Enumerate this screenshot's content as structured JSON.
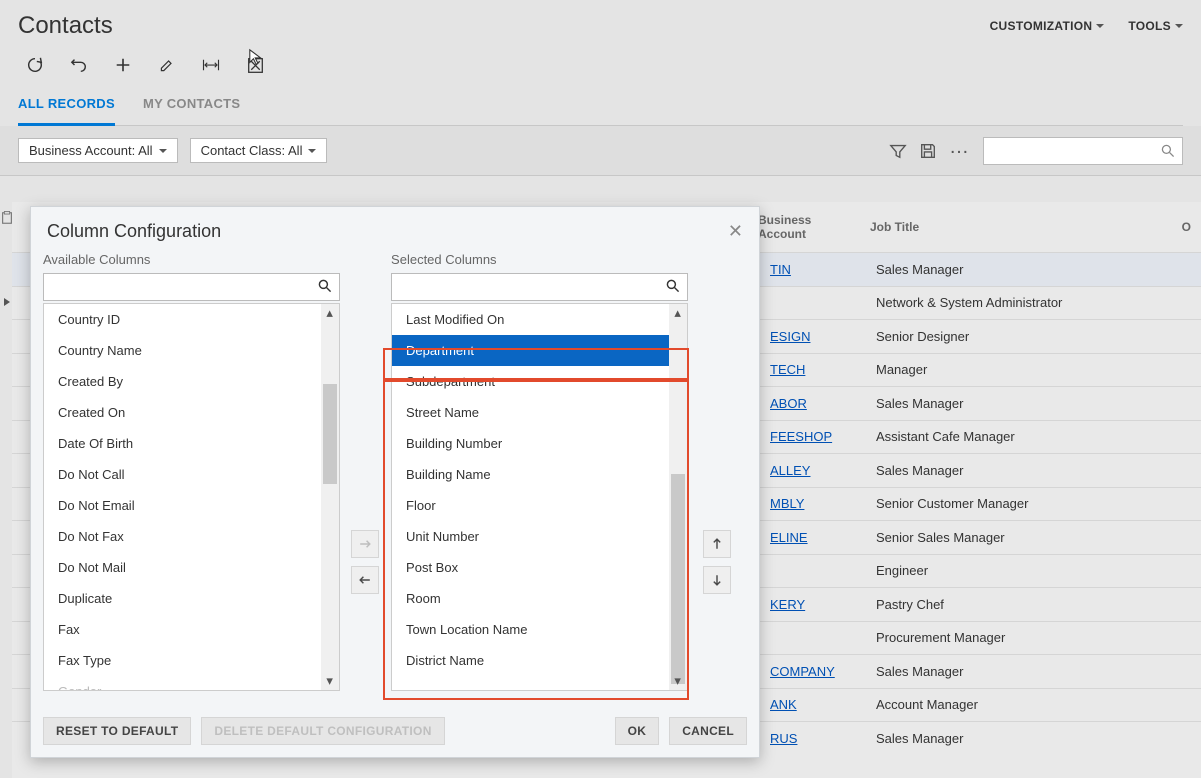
{
  "header": {
    "title": "Contacts",
    "menu": {
      "customization": "CUSTOMIZATION",
      "tools": "TOOLS"
    }
  },
  "tabs": {
    "all": "ALL RECORDS",
    "my": "MY CONTACTS"
  },
  "filters": {
    "businessAccount": "Business Account: All",
    "contactClass": "Contact Class: All"
  },
  "table": {
    "columns": {
      "business": "Business\nAccount",
      "jobTitle": "Job Title"
    },
    "rows": [
      {
        "business": "TIN",
        "jobTitle": "Sales Manager",
        "selected": true
      },
      {
        "business": "",
        "jobTitle": "Network & System Administrator"
      },
      {
        "business": "ESIGN",
        "jobTitle": "Senior Designer"
      },
      {
        "business": "TECH",
        "jobTitle": "Manager"
      },
      {
        "business": "ABOR",
        "jobTitle": "Sales Manager"
      },
      {
        "business": "FEESHOP",
        "jobTitle": "Assistant Cafe Manager"
      },
      {
        "business": "ALLEY",
        "jobTitle": "Sales Manager"
      },
      {
        "business": "MBLY",
        "jobTitle": "Senior Customer Manager"
      },
      {
        "business": "ELINE",
        "jobTitle": "Senior Sales Manager"
      },
      {
        "business": "",
        "jobTitle": "Engineer"
      },
      {
        "business": "KERY",
        "jobTitle": "Pastry Chef"
      },
      {
        "business": "",
        "jobTitle": "Procurement Manager"
      },
      {
        "business": "COMPANY",
        "jobTitle": "Sales Manager"
      },
      {
        "business": "ANK",
        "jobTitle": "Account Manager"
      },
      {
        "business": "RUS",
        "jobTitle": "Sales Manager"
      }
    ]
  },
  "dialog": {
    "title": "Column Configuration",
    "availableLabel": "Available Columns",
    "selectedLabel": "Selected Columns",
    "available": [
      "Country ID",
      "Country Name",
      "Created By",
      "Created On",
      "Date Of Birth",
      "Do Not Call",
      "Do Not Email",
      "Do Not Fax",
      "Do Not Mail",
      "Duplicate",
      "Fax",
      "Fax Type",
      "Gender"
    ],
    "selected": [
      {
        "label": "Last Modified On"
      },
      {
        "label": "Department",
        "selected": true
      },
      {
        "label": "Subdepartment"
      },
      {
        "label": "Street Name"
      },
      {
        "label": "Building Number"
      },
      {
        "label": "Building Name"
      },
      {
        "label": "Floor"
      },
      {
        "label": "Unit Number"
      },
      {
        "label": "Post Box"
      },
      {
        "label": "Room"
      },
      {
        "label": "Town Location Name"
      },
      {
        "label": "District Name"
      }
    ],
    "buttons": {
      "reset": "RESET TO DEFAULT",
      "deleteDefault": "DELETE DEFAULT CONFIGURATION",
      "ok": "OK",
      "cancel": "CANCEL"
    }
  }
}
